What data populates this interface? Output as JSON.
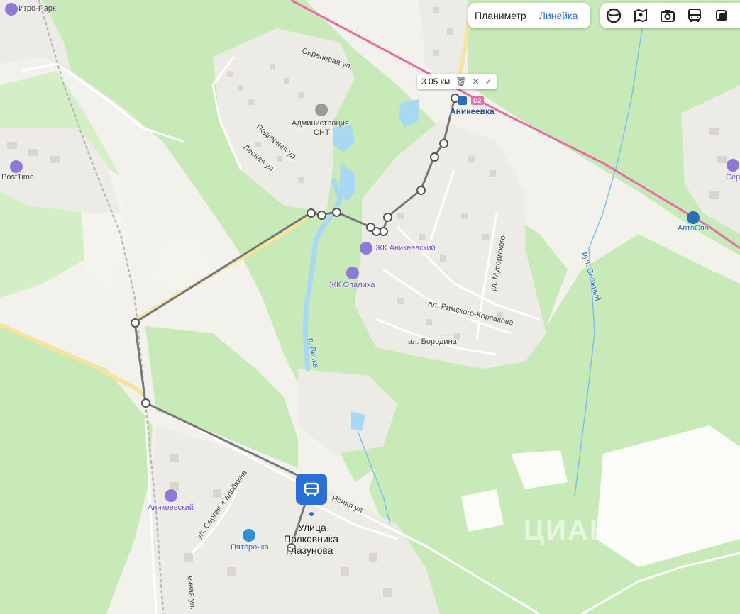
{
  "toolbar": {
    "planimeter_label": "Планиметр",
    "ruler_label": "Линейка",
    "layers": [
      {
        "name": "panorama-icon"
      },
      {
        "name": "map-layers-icon"
      },
      {
        "name": "photo-camera-icon"
      },
      {
        "name": "transport-bus-icon"
      },
      {
        "name": "traffic-icon"
      }
    ]
  },
  "ruler": {
    "distance": "3.05 км",
    "delete_icon": "trash-icon",
    "close_icon": "close-icon",
    "confirm_icon": "check-icon"
  },
  "places": {
    "igro_park": "Игро-Парк",
    "posttime": "PostTime",
    "sirenevaya": "Сиреневая ул.",
    "administration_line1": "Администрация",
    "administration_line2": "СНТ",
    "podgornaya": "Подгорная ул.",
    "lesnaya": "Лесная ул.",
    "station_badge": "D2",
    "station_name": "Аникеевка",
    "zhk_anikeevsky": "ЖК Аникеевский",
    "zhk_opaliha": "ЖК Опалиха",
    "musorgsky": "ул. Мусоргского",
    "rimsky": "ал. Римского-Корсакова",
    "borodina": "ал. Бородина",
    "river_lipka": "р. Липка",
    "stream": "руч. Снежный",
    "avtospa": "АвтоСпа",
    "sery": "Сер",
    "anikeevsky": "Аникеевский",
    "pyaterochka": "Пятёрочка",
    "zhadobkina": "ул. Сергея Жадобкина",
    "yasnaya": "Ясная ул.",
    "street_stop_line1": "Улица",
    "street_stop_line2": "Полковника",
    "street_stop_line3": "Глазунова",
    "vechnaya": "ечная ул.",
    "watermark": "ЦИАН"
  },
  "colors": {
    "accent": "#2a6fd6",
    "forest": "#c8eab8",
    "water": "#a9d8f2",
    "railway": "#e66ca5",
    "road_yellow": "#f7e39b",
    "ruler_line": "#777777"
  }
}
